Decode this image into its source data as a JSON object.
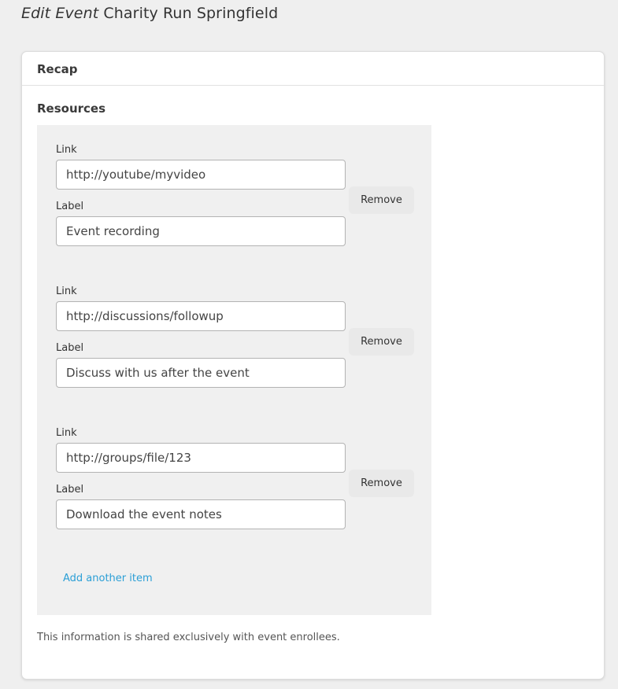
{
  "header": {
    "title_prefix": "Edit Event",
    "event_name": "Charity Run Springfield"
  },
  "card": {
    "title": "Recap"
  },
  "resources": {
    "section_title": "Resources",
    "link_label": "Link",
    "label_label": "Label",
    "remove_label": "Remove",
    "items": [
      {
        "link": "http://youtube/myvideo",
        "label": "Event recording"
      },
      {
        "link": "http://discussions/followup",
        "label": "Discuss with us after the event"
      },
      {
        "link": "http://groups/file/123",
        "label": "Download the event notes"
      }
    ],
    "add_label": "Add another item"
  },
  "help_text": "This information is shared exclusively with event enrollees.",
  "colors": {
    "background": "#efefef",
    "card": "#ffffff",
    "resources_panel": "#f0f0f0",
    "link": "#2b9fd6",
    "remove_button": "#e9e9e9"
  }
}
